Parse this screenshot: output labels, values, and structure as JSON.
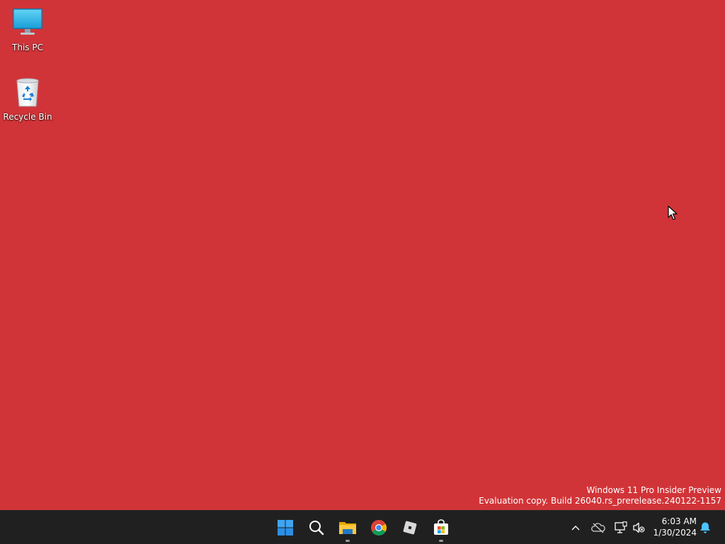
{
  "desktop": {
    "background_color": "#d13438",
    "icons": [
      {
        "label": "This PC",
        "icon": "monitor-icon"
      },
      {
        "label": "Recycle Bin",
        "icon": "recycle-bin-icon"
      }
    ]
  },
  "watermark": {
    "line1": "Windows 11 Pro Insider Preview",
    "line2": "Evaluation copy. Build 26040.rs_prerelease.240122-1157"
  },
  "taskbar": {
    "background_color": "#202020",
    "apps": [
      {
        "name": "Start",
        "icon": "windows-logo-icon"
      },
      {
        "name": "Search",
        "icon": "search-icon"
      },
      {
        "name": "File Explorer",
        "icon": "folder-icon",
        "running": true
      },
      {
        "name": "Google Chrome",
        "icon": "chrome-icon"
      },
      {
        "name": "Roblox",
        "icon": "roblox-icon"
      },
      {
        "name": "Microsoft Store",
        "icon": "store-icon",
        "running": true
      }
    ],
    "tray": {
      "icons": [
        "chevron-up-icon",
        "onedrive-offline-icon",
        "network-icon",
        "volume-muted-icon",
        "notification-bell-icon"
      ],
      "time": "6:03 AM",
      "date": "1/30/2024"
    }
  }
}
